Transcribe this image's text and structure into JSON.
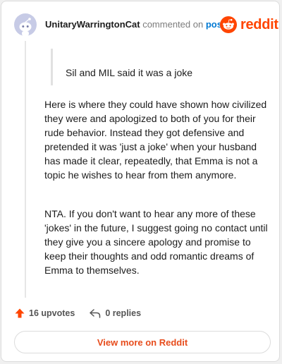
{
  "comment": {
    "username": "UnitaryWarringtonCat",
    "verb": "commented on",
    "post_link": "post",
    "quote": "Sil and MIL said it was a joke",
    "paragraphs": [
      "Here is where they could have shown how civilized they were and apologized to both of you for their rude behavior. Instead they got defensive and pretended it was 'just a joke' when your husband has made it clear, repeatedly, that Emma is not a topic he wishes to hear from them anymore.",
      "NTA. If you don't want to hear any more of these 'jokes' in the future, I suggest going no contact until they give you a sincere apology and promise to keep their thoughts and odd romantic dreams of Emma to themselves."
    ],
    "upvotes": "16 upvotes",
    "replies": "0 replies"
  },
  "brand": {
    "wordmark": "reddit",
    "color": "#ff4500"
  },
  "footer": {
    "view_more": "View more on Reddit"
  },
  "icons": {
    "avatar": "snoo-avatar-icon",
    "logo": "reddit-logo-icon",
    "upvote": "upvote-arrow-icon",
    "reply": "reply-arrow-icon"
  }
}
